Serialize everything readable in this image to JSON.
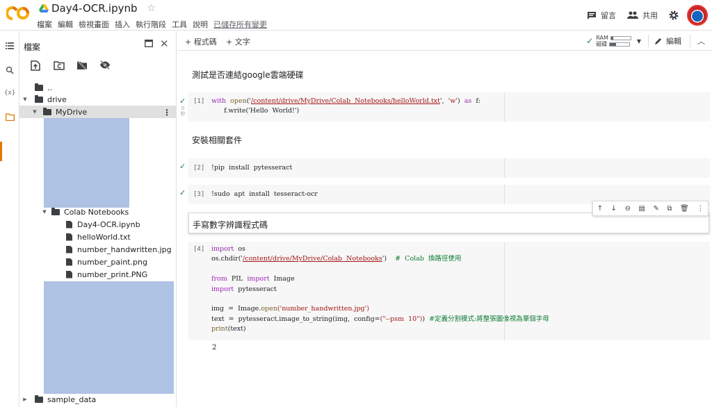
{
  "header": {
    "logo": "CO",
    "title": "Day4-OCR.ipynb",
    "menu": [
      "檔案",
      "編輯",
      "檢視畫面",
      "插入",
      "執行階段",
      "工具",
      "說明"
    ],
    "saved_status": "已儲存所有變更",
    "comment_label": "留言",
    "share_label": "共用"
  },
  "files_panel": {
    "title": "檔案",
    "tree": {
      "parent": "..",
      "drive": "drive",
      "mydrive": "MyDrive",
      "colab_notebooks": "Colab Notebooks",
      "files": [
        "Day4-OCR.ipynb",
        "helloWorld.txt",
        "number_handwritten.jpg",
        "number_paint.png",
        "number_print.PNG"
      ],
      "sample_data": "sample_data"
    }
  },
  "toolbar": {
    "add_code": "+ 程式碼",
    "add_text": "+ 文字",
    "ram_label": "RAM",
    "disk_label": "磁碟",
    "ram_fraction": 0.1,
    "disk_fraction": 0.3,
    "edit_label": "編輯"
  },
  "cells": {
    "text1": "測試是否連結google雲端硬碟",
    "code1": {
      "prompt": "[1]",
      "exec_time": "0\n秒",
      "line1": {
        "kw_with": "with",
        "fn_open": "open",
        "path": "/content/drive/MyDrive/Colab  Notebooks/helloWorld.txt",
        "mode": "'w'",
        "kw_as": "as",
        "var": "f:"
      },
      "line2": "f.write('Hello  World!')"
    },
    "text2": "安裝相關套件",
    "code2": {
      "prompt": "[2]",
      "code": "!pip  install  pytesseract"
    },
    "code3": {
      "prompt": "[3]",
      "code": "!sudo  apt  install  tesseract-ocr"
    },
    "text3": "手寫數字辨識程式碼",
    "code4": {
      "prompt": "[4]",
      "import_kw": "import",
      "import_mod": "os",
      "chdir_pre": "os.chdir('",
      "chdir_path": "/content/drive/MyDrive/Colab  Notebooks",
      "chdir_post": "')",
      "chdir_comment": "#  Colab  換路徑使用",
      "from_kw": "from",
      "from_mod": "PIL",
      "from_import": "Image",
      "import2_mod": "pytesseract",
      "img_pre": "img  =  Image.",
      "img_fn": "open",
      "img_arg": "('number_handwritten.jpg')",
      "text_pre": "text  =  pytesseract.image_to_string(img,  config=",
      "text_arg": "(\"--psm  10\")",
      "text_post": ")",
      "text_comment": "#定義分割模式:將整張圖像視為單個字母",
      "print_fn": "print",
      "print_arg": "(text)",
      "output": "2"
    }
  }
}
